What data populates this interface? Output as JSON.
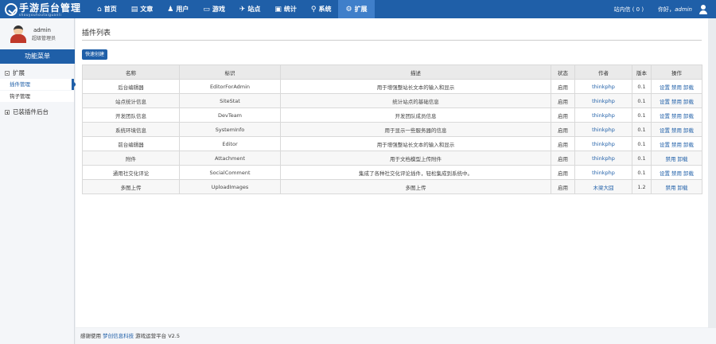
{
  "header": {
    "logo_title": "手游后台管理",
    "logo_sub": "shouyouhoutaiguanli",
    "nav": [
      {
        "icon": "⌂",
        "icon_name": "home-icon",
        "label": "首页"
      },
      {
        "icon": "▤",
        "icon_name": "article-icon",
        "label": "文章"
      },
      {
        "icon": "♟",
        "icon_name": "user-group-icon",
        "label": "用户"
      },
      {
        "icon": "▭",
        "icon_name": "game-icon",
        "label": "游戏"
      },
      {
        "icon": "✈",
        "icon_name": "site-icon",
        "label": "站点"
      },
      {
        "icon": "▣",
        "icon_name": "monitor-icon",
        "label": "统计"
      },
      {
        "icon": "⚲",
        "icon_name": "link-icon",
        "label": "系统"
      },
      {
        "icon": "⚙",
        "icon_name": "gear-icon",
        "label": "扩展"
      }
    ],
    "message": "站内信 ( 0 )",
    "greeting": "你好，",
    "username": "admin"
  },
  "sidebar": {
    "admin_name": "admin",
    "admin_role": "超级管理员",
    "menu_title": "功能菜单",
    "group1": "扩展",
    "items": [
      "插件管理",
      "钩子管理"
    ],
    "group2": "已装插件后台"
  },
  "main": {
    "title": "插件列表",
    "quick_button": "快速创建",
    "columns": [
      "名称",
      "标识",
      "描述",
      "状态",
      "作者",
      "版本",
      "操作"
    ],
    "rows": [
      {
        "name": "后台编辑器",
        "key": "EditorForAdmin",
        "desc": "用于增强整站长文本的输入和显示",
        "status": "启用",
        "author": "thinkphp",
        "version": "0.1",
        "ops": [
          "设置",
          "禁用",
          "卸载"
        ]
      },
      {
        "name": "站点统计信息",
        "key": "SiteStat",
        "desc": "统计站点的基础信息",
        "status": "启用",
        "author": "thinkphp",
        "version": "0.1",
        "ops": [
          "设置",
          "禁用",
          "卸载"
        ]
      },
      {
        "name": "开发团队信息",
        "key": "DevTeam",
        "desc": "开发团队成员信息",
        "status": "启用",
        "author": "thinkphp",
        "version": "0.1",
        "ops": [
          "设置",
          "禁用",
          "卸载"
        ]
      },
      {
        "name": "系统环境信息",
        "key": "SystemInfo",
        "desc": "用于显示一些服务器的信息",
        "status": "启用",
        "author": "thinkphp",
        "version": "0.1",
        "ops": [
          "设置",
          "禁用",
          "卸载"
        ]
      },
      {
        "name": "前台编辑器",
        "key": "Editor",
        "desc": "用于增强整站长文本的输入和显示",
        "status": "启用",
        "author": "thinkphp",
        "version": "0.1",
        "ops": [
          "设置",
          "禁用",
          "卸载"
        ]
      },
      {
        "name": "附件",
        "key": "Attachment",
        "desc": "用于文档模型上传附件",
        "status": "启用",
        "author": "thinkphp",
        "version": "0.1",
        "ops": [
          "禁用",
          "卸载"
        ]
      },
      {
        "name": "通用社交化评论",
        "key": "SocialComment",
        "desc": "集成了各种社交化评论插件，轻松集成到系统中。",
        "status": "启用",
        "author": "thinkphp",
        "version": "0.1",
        "ops": [
          "设置",
          "禁用",
          "卸载"
        ]
      },
      {
        "name": "多图上传",
        "key": "UploadImages",
        "desc": "多图上传",
        "status": "启用",
        "author": "木梁大囧",
        "version": "1.2",
        "ops": [
          "禁用",
          "卸载"
        ]
      }
    ]
  },
  "footer": {
    "prefix": "感谢使用",
    "brand": "梦创信息科技",
    "suffix": "游戏运营平台 V2.5"
  },
  "colors": {
    "primary": "#1f5fa8",
    "active_nav": "#3f7fca"
  }
}
